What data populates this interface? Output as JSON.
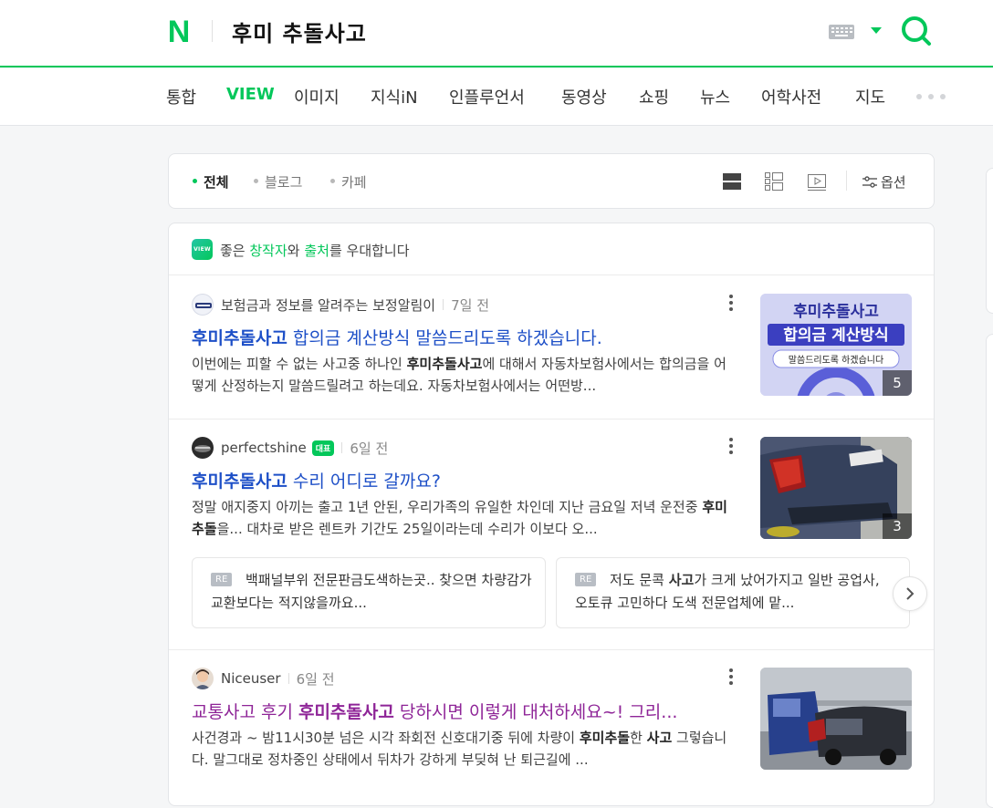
{
  "header": {
    "query": "후미 추돌사고",
    "logo_letter": "N",
    "brand_color": "#03c75a"
  },
  "tabs": [
    "통합",
    "VIEW",
    "이미지",
    "지식iN",
    "인플루언서",
    "동영상",
    "쇼핑",
    "뉴스",
    "어학사전",
    "지도"
  ],
  "active_tab": "VIEW",
  "filter": {
    "items": [
      "전체",
      "블로그",
      "카페"
    ],
    "active": "전체",
    "option_label": "옵션",
    "view_icons": [
      "list-view-icon",
      "compact-view-icon",
      "video-view-icon"
    ]
  },
  "notice": {
    "badge": "VIEW",
    "pre": "좋은 ",
    "creator": "창작자",
    "mid": "와 ",
    "source": "출처",
    "post": "를 우대합니다"
  },
  "posts": [
    {
      "author": "보험금과 정보를 알려주는 보정알림이",
      "time": "7일 전",
      "title_bold": "후미추돌사고",
      "title_rest": " 합의금 계산방식 말씀드리도록 하겠습니다.",
      "desc_1": "이번에는 피할 수 없는 사고중 하나인 ",
      "desc_bold": "후미추돌사고",
      "desc_2": "에 대해서 자동차보험사에서는 합의금을 어떻게 산정하는지 말씀드릴려고 하는데요. 자동차보험사에서는 어떤방...",
      "thumb_title": "후미추돌사고",
      "thumb_sub": "합의금 계산방식",
      "thumb_pill": "말씀드리도록 하겠습니다",
      "thumb_count": "5"
    },
    {
      "author": "perfectshine",
      "badge": "대표",
      "time": "6일 전",
      "title_bold": "후미추돌사고",
      "title_rest": " 수리 어디로 갈까요?",
      "desc_1": "정말 애지중지 아끼는 출고 1년 안된, 우리가족의 유일한 차인데 지난 금요일 저녁 운전중 ",
      "desc_bold": "후미추돌",
      "desc_2": "을... 대차로 받은 렌트카 기간도 25일이라는데 수리가 이보다 오...",
      "thumb_count": "3",
      "subs": [
        {
          "re": "RE",
          "text": "백패널부위 전문판금도색하는곳.. 찾으면 차량감가교환보다는 적지않을까요..."
        },
        {
          "re": "RE",
          "text_1": "저도 문콕 ",
          "text_bold": "사고",
          "text_2": "가 크게 났어가지고 일반 공업사, 오토큐 고민하다 도색 전문업체에 맡..."
        }
      ]
    },
    {
      "author": "Niceuser",
      "time": "6일 전",
      "title_pre": "교통사고 후기 ",
      "title_bold": "후미추돌사고",
      "title_rest": " 당하시면 이렇게 대처하세요~! 그리...",
      "desc_1": "사건경과 ~ 밤11시30분 넘은 시각 좌회전 신호대기중 뒤에 차량이 ",
      "desc_bold": "후미추돌",
      "desc_2": "한 ",
      "desc_bold2": "사고",
      "desc_3": " 그렇습니다. 말그대로 정차중인 상태에서 뒤차가 강하게 부딪혀 난 퇴근길에 ..."
    }
  ]
}
